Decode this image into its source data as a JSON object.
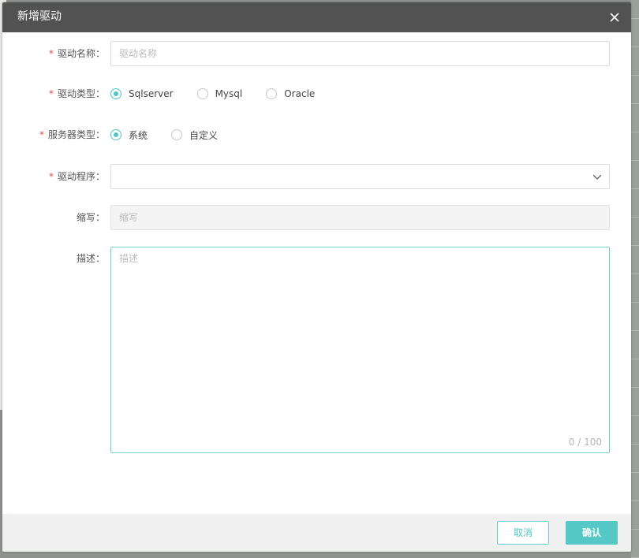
{
  "dialog": {
    "title": "新增驱动",
    "close_icon": "close-icon"
  },
  "form": {
    "driver_name": {
      "label": "驱动名称：",
      "required": "*",
      "placeholder": "驱动名称",
      "value": ""
    },
    "driver_type": {
      "label": "驱动类型：",
      "required": "*",
      "options": [
        "Sqlserver",
        "Mysql",
        "Oracle"
      ],
      "selected": "Sqlserver"
    },
    "server_type": {
      "label": "服务器类型：",
      "required": "*",
      "options": [
        "系统",
        "自定义"
      ],
      "selected": "系统"
    },
    "driver_program": {
      "label": "驱动程序：",
      "required": "*",
      "value": "",
      "icon": "chevron-down-icon"
    },
    "abbreviation": {
      "label": "缩写：",
      "placeholder": "缩写",
      "value": "",
      "disabled": true
    },
    "description": {
      "label": "描述：",
      "placeholder": "描述",
      "value": "",
      "counter": "0 / 100"
    }
  },
  "footer": {
    "cancel_label": "取消",
    "confirm_label": "确认"
  },
  "colors": {
    "accent": "#4fc6c5",
    "header_bg": "#525252",
    "required": "#e04b4b",
    "footer_bg": "#f0f0f0"
  }
}
